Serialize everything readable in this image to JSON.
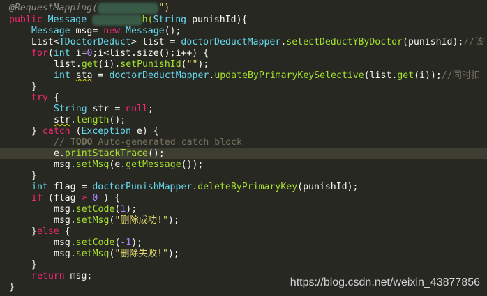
{
  "code": {
    "l1": {
      "annotation": "@RequestMapping(",
      "tail": "\")"
    },
    "l2": {
      "a": "public",
      "b": "Message",
      "c": "h(",
      "d": "String",
      "e": " punishId){"
    },
    "l3": {
      "a": "Message",
      "b": " msg",
      "c": "= ",
      "d": "new",
      "e": " Message",
      "f": "();"
    },
    "l4": {
      "a": "List<",
      "b": "TDoctorDeduct",
      "c": "> list = ",
      "d": "doctorDeductMapper",
      "e": ".",
      "f": "selectDeductYByDoctor",
      "g": "(punishId);",
      "h": "//该"
    },
    "l5": {
      "a": "for",
      "b": "(",
      "c": "int",
      "d": " i=",
      "e": "0",
      "f": ";i<list.size();i++) {"
    },
    "l6": {
      "a": "list.",
      "b": "get",
      "c": "(i).",
      "d": "setPunishId",
      "e": "(",
      "f": "\"\"",
      "g": ");"
    },
    "l7": {
      "a": "int",
      "b": "sta",
      "c": " = ",
      "d": "doctorDeductMapper",
      "e": ".",
      "f": "updateByPrimaryKeySelective",
      "g": "(list.",
      "h": "get",
      "i": "(i));",
      "j": "//同时扣"
    },
    "l8": {
      "a": "}"
    },
    "l9": {
      "a": "try",
      "b": " {"
    },
    "l10": {
      "a": "String",
      "b": " str = ",
      "c": "null",
      "d": ";"
    },
    "l11": {
      "a": "str",
      "b": ".",
      "c": "length",
      "d": "();"
    },
    "l12": {
      "a": "} ",
      "b": "catch",
      "c": " (",
      "d": "Exception",
      "e": " e) {"
    },
    "l13": {
      "a": "// ",
      "b": "TODO",
      "c": " Auto-generated catch block"
    },
    "l14": {
      "a": "e.",
      "b": "printStackTrace",
      "c": "();"
    },
    "l15": {
      "a": "msg.",
      "b": "setMsg",
      "c": "(e.",
      "d": "getMessage",
      "e": "());"
    },
    "l16": {
      "a": "}"
    },
    "l17": {
      "a": "int",
      "b": " flag = ",
      "c": "doctorPunishMapper",
      "d": ".",
      "e": "deleteByPrimaryKey",
      "f": "(punishId);"
    },
    "l18": {
      "a": "if",
      "b": " (flag ",
      "c": ">",
      "d": " ",
      "e": "0",
      "f": " ) {"
    },
    "l19": {
      "a": "msg.",
      "b": "setCode",
      "c": "(",
      "d": "1",
      "e": ");"
    },
    "l20": {
      "a": "msg.",
      "b": "setMsg",
      "c": "(",
      "d": "\"删除成功!\"",
      "e": ");"
    },
    "l21": {
      "a": "}",
      "b": "else",
      "c": " {"
    },
    "l22": {
      "a": "msg.",
      "b": "setCode",
      "c": "(",
      "d": "-1",
      "e": ");"
    },
    "l23": {
      "a": "msg.",
      "b": "setMsg",
      "c": "(",
      "d": "\"删除失败!\"",
      "e": ");"
    },
    "l24": {
      "a": "}"
    },
    "l25": {
      "a": "return",
      "b": " msg;"
    },
    "l26": {
      "a": "}"
    }
  },
  "watermark": "https://blog.csdn.net/weixin_43877856",
  "colors": {
    "background": "#272822",
    "keyword": "#66d9ef",
    "function": "#a6e22e",
    "string": "#e6db74",
    "number": "#ae81ff",
    "comment": "#75715e",
    "current_line": "#3e3d32"
  }
}
